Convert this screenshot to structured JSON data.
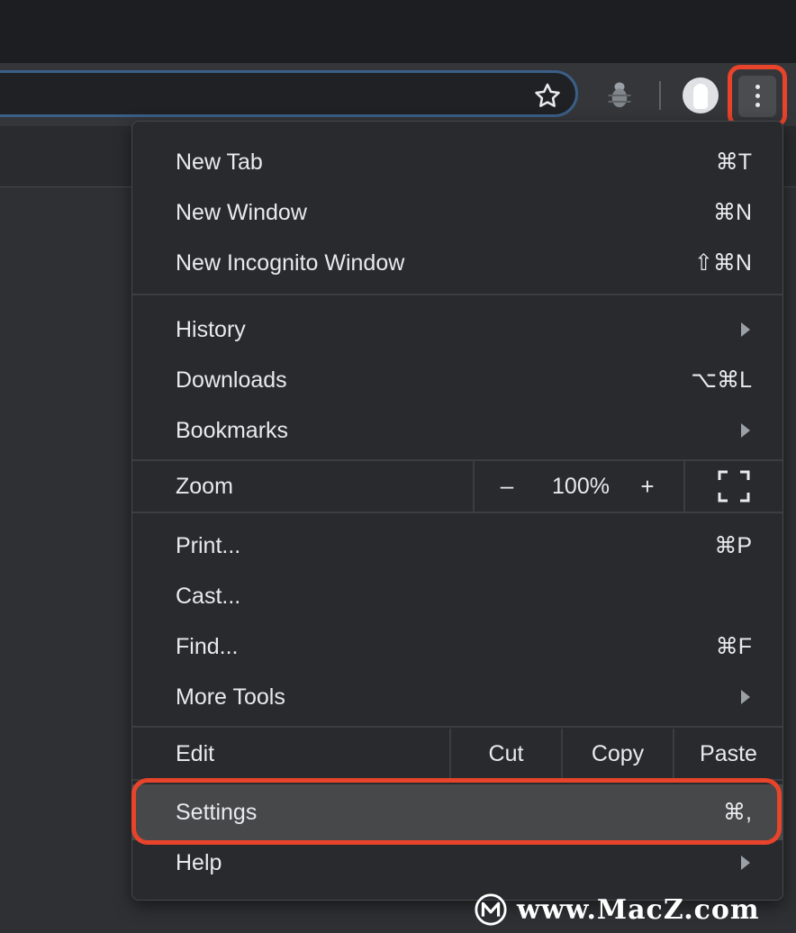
{
  "menu": {
    "items": [
      {
        "label": "New Tab",
        "shortcut": "⌘T"
      },
      {
        "label": "New Window",
        "shortcut": "⌘N"
      },
      {
        "label": "New Incognito Window",
        "shortcut": "⇧⌘N"
      },
      {
        "label": "History",
        "shortcut": ""
      },
      {
        "label": "Downloads",
        "shortcut": "⌥⌘L"
      },
      {
        "label": "Bookmarks",
        "shortcut": ""
      },
      {
        "label": "Print...",
        "shortcut": "⌘P"
      },
      {
        "label": "Cast...",
        "shortcut": ""
      },
      {
        "label": "Find...",
        "shortcut": "⌘F"
      },
      {
        "label": "More Tools",
        "shortcut": ""
      },
      {
        "label": "Settings",
        "shortcut": "⌘,"
      },
      {
        "label": "Help",
        "shortcut": ""
      }
    ],
    "zoom": {
      "label": "Zoom",
      "minus": "–",
      "value": "100%",
      "plus": "+"
    },
    "edit": {
      "label": "Edit",
      "cut": "Cut",
      "copy": "Copy",
      "paste": "Paste"
    }
  },
  "watermark": {
    "text": "www.MacZ.com"
  },
  "colors": {
    "highlight": "#e8432b",
    "menu_bg": "#292a2d",
    "toolbar_bg": "#35363a",
    "omnibox_border": "#3a5f88"
  }
}
